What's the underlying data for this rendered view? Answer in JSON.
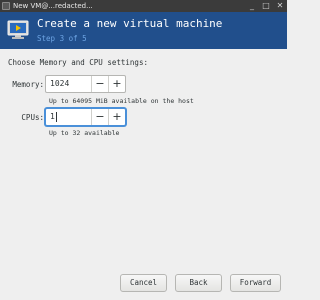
{
  "window": {
    "title": "New VM@...redacted...",
    "icons": {
      "app": "app-icon",
      "minimize": "minimize-icon",
      "maximize": "maximize-icon",
      "close": "close-icon"
    }
  },
  "header": {
    "title": "Create a new virtual machine",
    "step": "Step 3 of 5",
    "icon": "virtual-machine-icon",
    "background": "#214f8c"
  },
  "form": {
    "section_label": "Choose Memory and CPU settings:",
    "memory": {
      "label": "Memory:",
      "value": "1024",
      "hint": "Up to 64095 MiB available on the host"
    },
    "cpus": {
      "label": "CPUs:",
      "value": "1",
      "hint": "Up to 32 available"
    },
    "minus": "−",
    "plus": "+"
  },
  "buttons": {
    "cancel": "Cancel",
    "back": "Back",
    "forward": "Forward"
  }
}
